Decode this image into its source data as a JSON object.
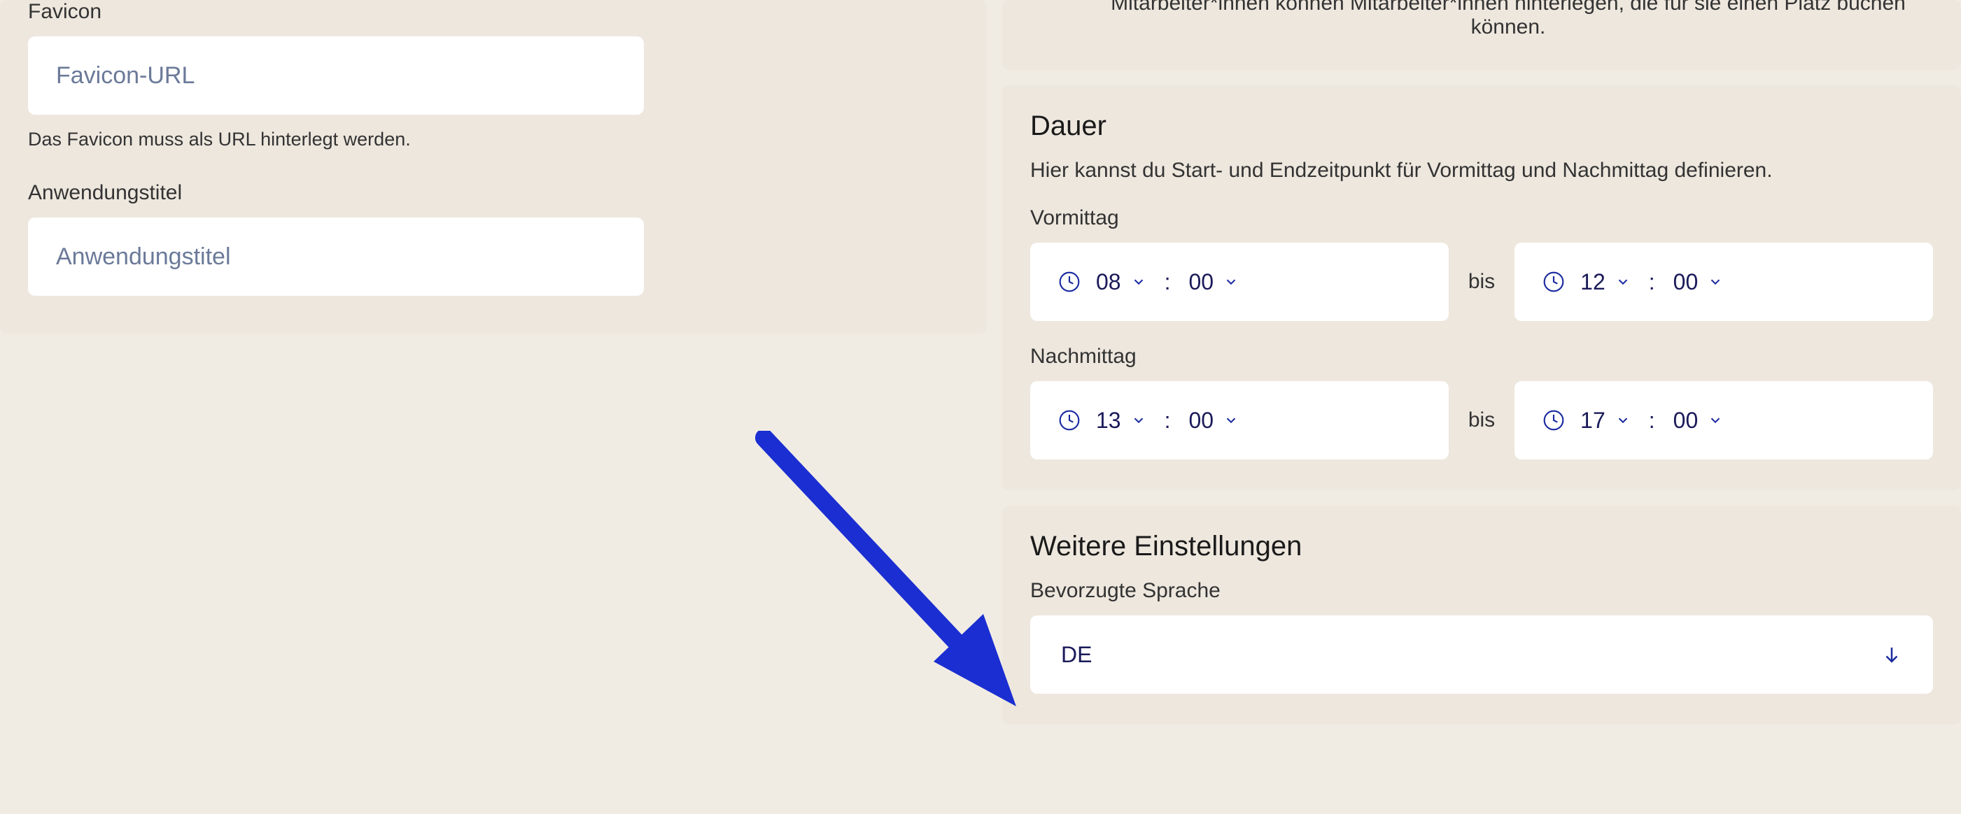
{
  "left": {
    "favicon": {
      "label": "Favicon",
      "placeholder": "Favicon-URL",
      "helper": "Das Favicon muss als URL hinterlegt werden."
    },
    "appTitle": {
      "label": "Anwendungstitel",
      "placeholder": "Anwendungstitel"
    }
  },
  "right": {
    "topNote": "Mitarbeiter*innen können Mitarbeiter*innen hinterlegen, die für sie einen Platz buchen können.",
    "dauer": {
      "title": "Dauer",
      "desc": "Hier kannst du Start- und Endzeitpunkt für Vormittag und Nachmittag definieren.",
      "vormittag": {
        "label": "Vormittag",
        "startHour": "08",
        "startMin": "00",
        "endHour": "12",
        "endMin": "00"
      },
      "nachmittag": {
        "label": "Nachmittag",
        "startHour": "13",
        "startMin": "00",
        "endHour": "17",
        "endMin": "00"
      },
      "sep": "bis",
      "colon": ":"
    },
    "weitere": {
      "title": "Weitere Einstellungen",
      "languageLabel": "Bevorzugte Sprache",
      "languageValue": "DE"
    }
  }
}
